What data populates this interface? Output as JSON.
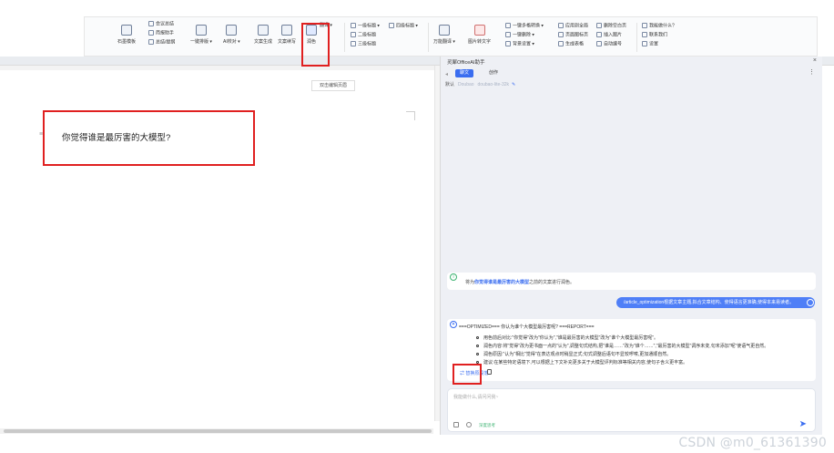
{
  "ribbon": {
    "group1": {
      "big_label": "石墨模板",
      "items": [
        "会议总结",
        "简报助手",
        "总结/提纲"
      ]
    },
    "yijian_paiban": "一键排版",
    "ai_jiaodui": "AI校对",
    "wenan_shengcheng": "文案生成",
    "wenan_xiuxie": "文案续写",
    "runse": "润色",
    "fanyi": "翻译",
    "headings": [
      "一级标题",
      "二级标题",
      "三级标题",
      "四级标题"
    ],
    "wanneng_fanyi": "万能翻译",
    "tupian_zhuan_wenzi": "图片转文字",
    "col_a": [
      "一键多格转换",
      "一键删除",
      "背景设置"
    ],
    "col_b": [
      "应用到全局",
      "页面图标页",
      "生成表格"
    ],
    "col_c": [
      "删除空白页",
      "插入图片",
      "自动编号"
    ],
    "col_d": [
      "我能做什么?",
      "联系我们",
      "设置"
    ]
  },
  "document": {
    "tooltip": "双击编辑页眉",
    "question": "你觉得谁是最厉害的大模型?",
    "margin_mark": "≡"
  },
  "panel": {
    "title": "灵犀OfficeAI助手",
    "close": "×",
    "menu": "⋮",
    "tabs": {
      "active": "聊文",
      "idle": "创作"
    },
    "model_label": "默认",
    "models": [
      "Doubao",
      "doubao-lite-32k"
    ],
    "system_msg_prefix": "将为",
    "system_msg_highlight": "你觉得谁是最厉害的大模型",
    "system_msg_suffix": "之前的文案进行润色。",
    "user_msg": "/article_optimization根据文章主题,拟合文章结构、使得语言更准确,使得本来易读者。",
    "response": {
      "head": "===OPTIMIZED=== 你认为谁个大模型最厉害呢? ===REPORT===",
      "bullets": [
        "用色前后对比:\"你觉得\"改为\"你认为\",\"谁是最厉害的大模型\"改为\"谁个大模型最厉害呢\"。",
        "润色内容:将\"觉得\"改为更书面一点的\"认为\",调整句式结构,把\"谁是……\"改为\"谁个……\",\"最厉害的大模型\"调序未变,句末添加\"呢\"使语气更自然。",
        "润色原因:\"认为\"相比\"觉得\"在表达观点时稍显正式;句式调整后语句不显较啰嗦,更加通顺自然。",
        "建议:在某些特定语境下,可以根据上下文补充更多关于大模型评判标准等相关内容,使句子含义更丰富。"
      ],
      "action": "替换原段落"
    },
    "input_placeholder": "我能做什么,请问问我~",
    "input_label": "深度思考"
  },
  "watermark": "CSDN @m0_61361390"
}
